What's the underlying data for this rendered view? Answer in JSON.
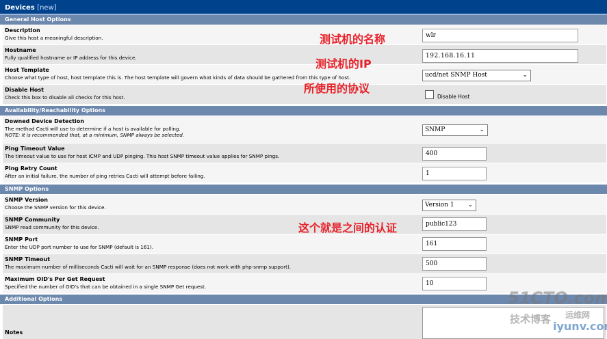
{
  "header": {
    "title": "Devices",
    "new_label": "[new]"
  },
  "sections": {
    "general": "General Host Options",
    "availability": "Availability/Reachability Options",
    "snmp": "SNMP Options",
    "additional": "Additional Options"
  },
  "fields": {
    "description": {
      "label": "Description",
      "desc": "Give this host a meaningful description.",
      "value": "wlr"
    },
    "hostname": {
      "label": "Hostname",
      "desc": "Fully qualified hostname or IP address for this device.",
      "value": "192.168.16.11"
    },
    "host_template": {
      "label": "Host Template",
      "desc": "Choose what type of host, host template this is. The host template will govern what kinds of data should be gathered from this type of host.",
      "value": "ucd/net SNMP Host"
    },
    "disable_host": {
      "label": "Disable Host",
      "desc": "Check this box to disable all checks for this host.",
      "checkbox_label": "Disable Host"
    },
    "downed_detection": {
      "label": "Downed Device Detection",
      "desc": "The method Cacti will use to determine if a host is available for polling.",
      "note": "NOTE: It is recommended that, at a minimum, SNMP always be selected.",
      "value": "SNMP"
    },
    "ping_timeout": {
      "label": "Ping Timeout Value",
      "desc": "The timeout value to use for host ICMP and UDP pinging. This host SNMP timeout value applies for SNMP pings.",
      "value": "400"
    },
    "ping_retry": {
      "label": "Ping Retry Count",
      "desc": "After an initial failure, the number of ping retries Cacti will attempt before failing.",
      "value": "1"
    },
    "snmp_version": {
      "label": "SNMP Version",
      "desc": "Choose the SNMP version for this device.",
      "value": "Version 1"
    },
    "snmp_community": {
      "label": "SNMP Community",
      "desc": "SNMP read community for this device.",
      "value": "public123"
    },
    "snmp_port": {
      "label": "SNMP Port",
      "desc": "Enter the UDP port number to use for SNMP (default is 161).",
      "value": "161"
    },
    "snmp_timeout": {
      "label": "SNMP Timeout",
      "desc": "The maximum number of milliseconds Cacti will wait for an SNMP response (does not work with php-snmp support).",
      "value": "500"
    },
    "max_oids": {
      "label": "Maximum OID's Per Get Request",
      "desc": "Specified the number of OID's that can be obtained in a single SNMP Get request.",
      "value": "10"
    },
    "notes": {
      "label": "Notes"
    }
  },
  "annotations": {
    "name": "测试机的名称",
    "ip": "测试机的IP",
    "protocol": "所使用的协议",
    "community": "这个就是之间的认证"
  },
  "watermark": {
    "site": "51CTO.com",
    "sub1": "技术博客",
    "sub2": "运维网",
    "sub3": "iyunv.com"
  },
  "colors": {
    "title_bg": "#00438c",
    "section_bg": "#6d88ad",
    "row_light": "#f5f5f5",
    "row_dark": "#e5e5e5",
    "annotation": "#e8222a"
  }
}
